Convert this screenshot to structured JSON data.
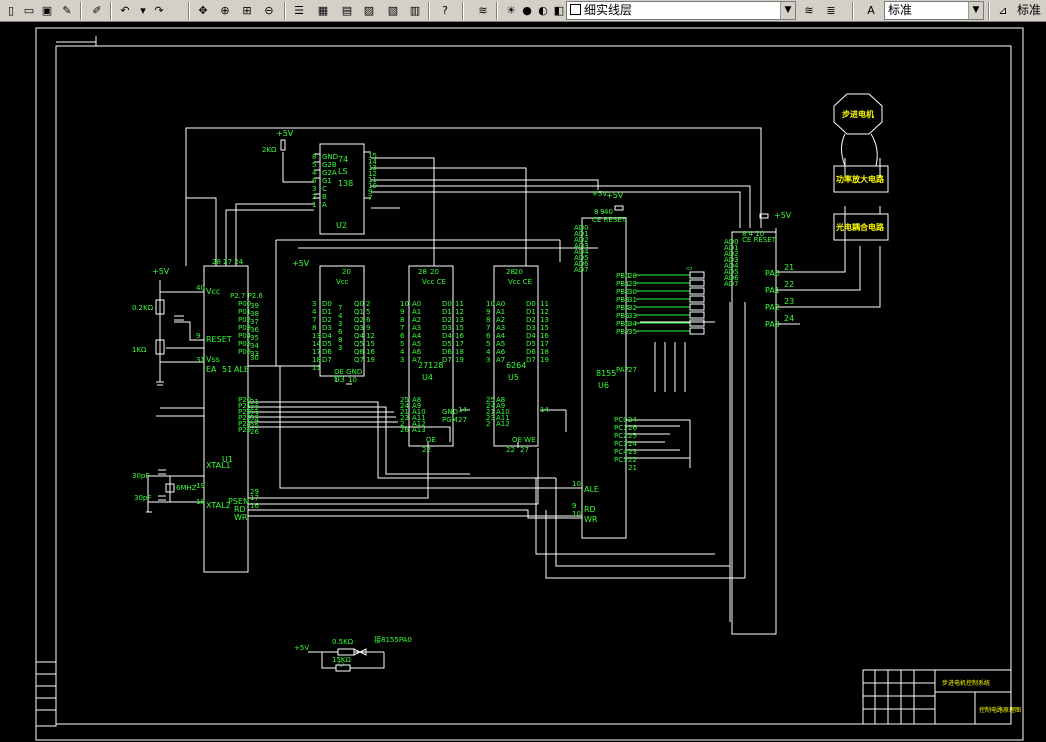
{
  "toolbar": {
    "layer_name": "细实线层",
    "text_style": "标准",
    "dim_style": "标准"
  },
  "power": {
    "vcc": "+5V"
  },
  "u2": {
    "ref": "U2",
    "l1": "74",
    "l2": "LS",
    "l3": "138",
    "pins_left": [
      "GND",
      "G2B",
      "G2A",
      "G1",
      "C",
      "B",
      "A"
    ],
    "pins_right": [
      "15",
      "14",
      "13",
      "12",
      "11",
      "10",
      "9",
      "7"
    ]
  },
  "u1": {
    "ref": "U1",
    "name": "51",
    "rst": "RESET",
    "ea": "EA",
    "ale": "ALE",
    "xtal1": "XTAL1",
    "xtal2": "XTAL2",
    "psen": "PSEN",
    "rd": "RD",
    "wr": "WR",
    "vcc": "Vcc",
    "vss": "Vss"
  },
  "u4": {
    "ref": "U4",
    "name": "27128"
  },
  "u5": {
    "ref": "U5",
    "name": "6264"
  },
  "u6": {
    "ref": "U6",
    "name": "8155",
    "ale": "ALE",
    "rd": "RD",
    "wr": "WR",
    "ce": "CE"
  },
  "u3": {
    "ref": "U3"
  },
  "parts": {
    "r1": "2KΩ",
    "r2": "0.2KΩ",
    "r3": "1KΩ",
    "c1": "30pF",
    "c2": "30pF",
    "xtal": "6MHZ",
    "bottom_v": "+5V",
    "bottom_r1": "0.5KΩ",
    "bottom_r2": "15KΩ",
    "bottom_net": "接8155PA0"
  },
  "right_blocks": {
    "motor": "步进电机",
    "amp": "功率放大电路",
    "opto": "光电耦合电路"
  },
  "pa_pins": [
    {
      "name": "PA0",
      "num": "21"
    },
    {
      "name": "PA1",
      "num": "22"
    },
    {
      "name": "PA2",
      "num": "23"
    },
    {
      "name": "PA3",
      "num": "24"
    }
  ],
  "title_block": {
    "project": "步进电机控制系统",
    "drawing": "控制电路原理图"
  }
}
